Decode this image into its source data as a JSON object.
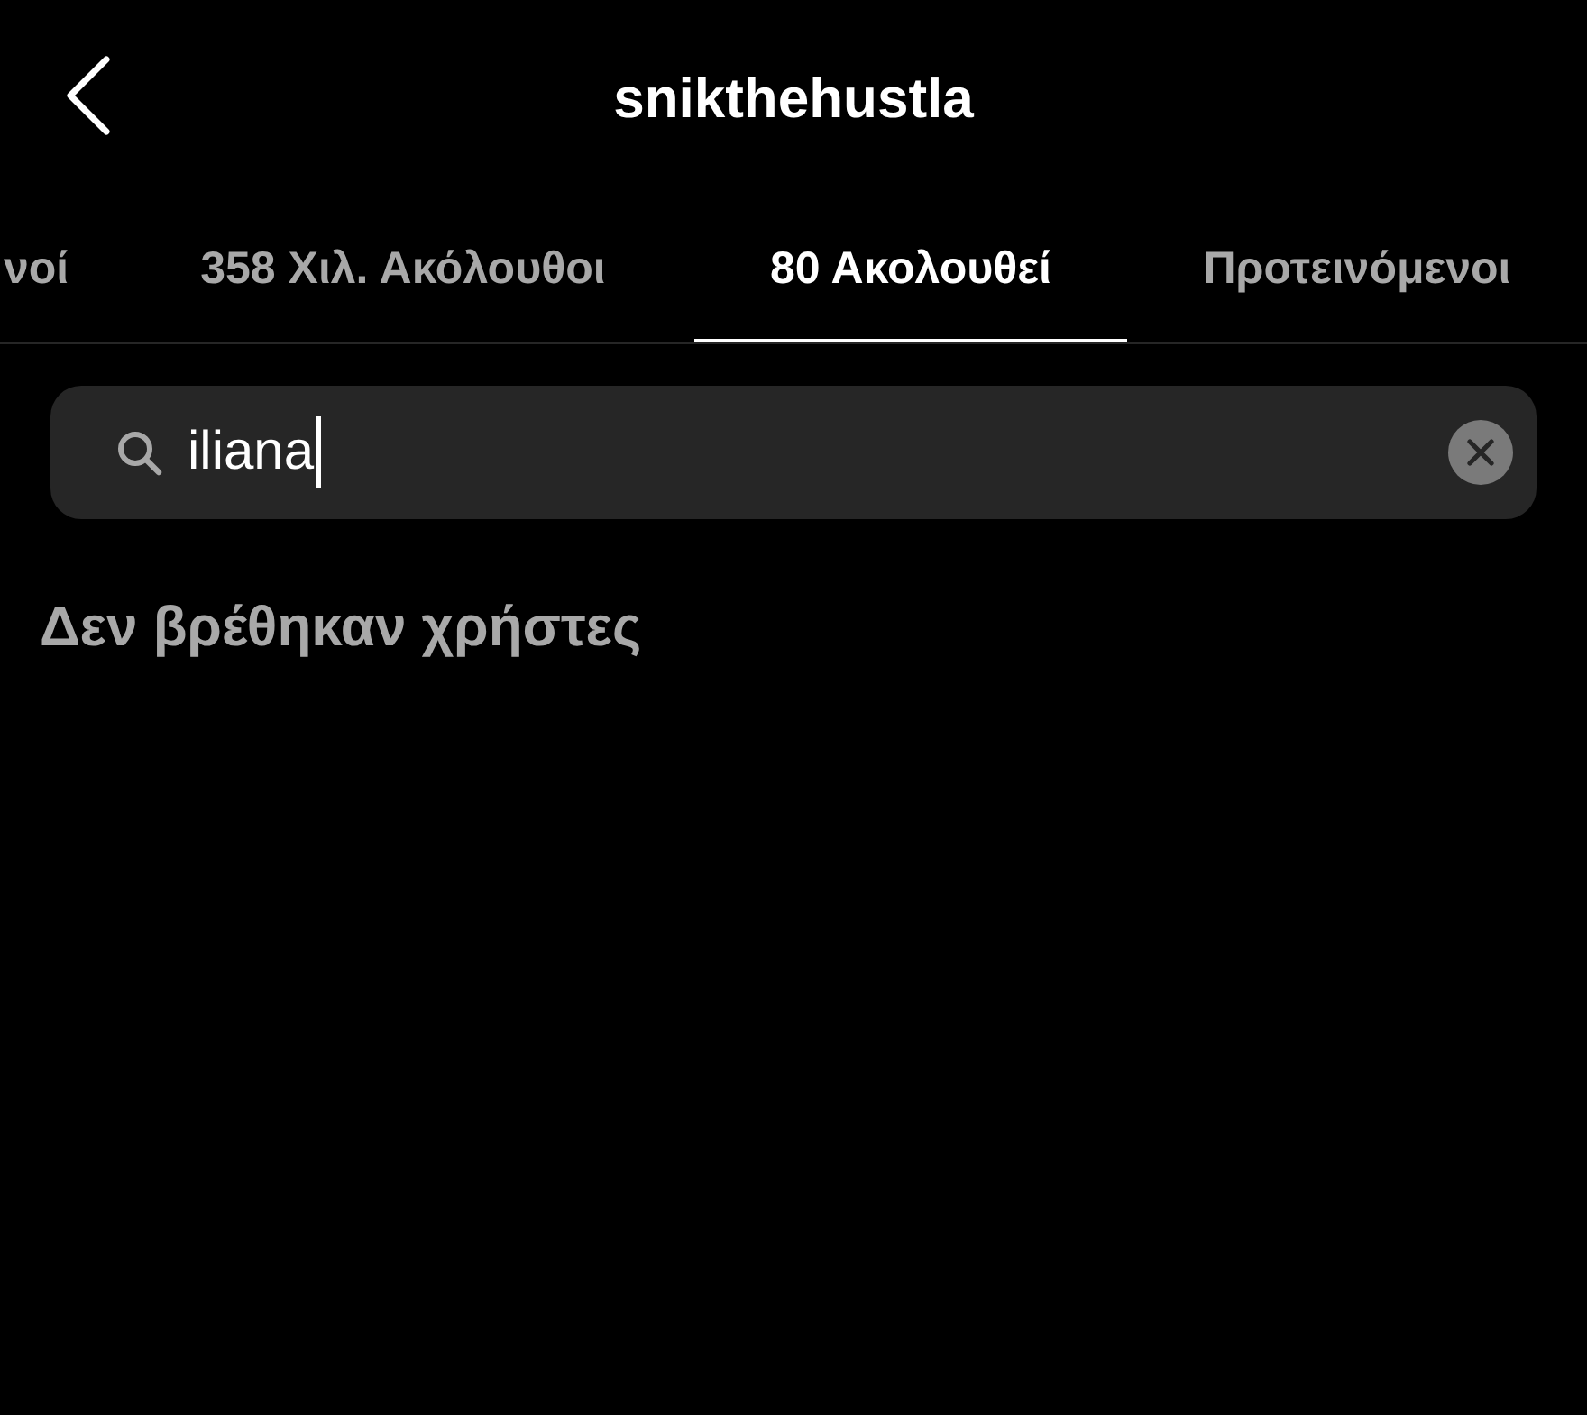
{
  "header": {
    "title": "snikthehustla"
  },
  "tabs": [
    {
      "label": "νοί",
      "selected": false
    },
    {
      "label": "358 Χιλ. Ακόλουθοι",
      "selected": false
    },
    {
      "label": "80 Ακολουθεί",
      "selected": true
    },
    {
      "label": "Προτεινόμενοι",
      "selected": false
    }
  ],
  "search": {
    "value": "iliana"
  },
  "empty_message": "Δεν βρέθηκαν χρήστες"
}
